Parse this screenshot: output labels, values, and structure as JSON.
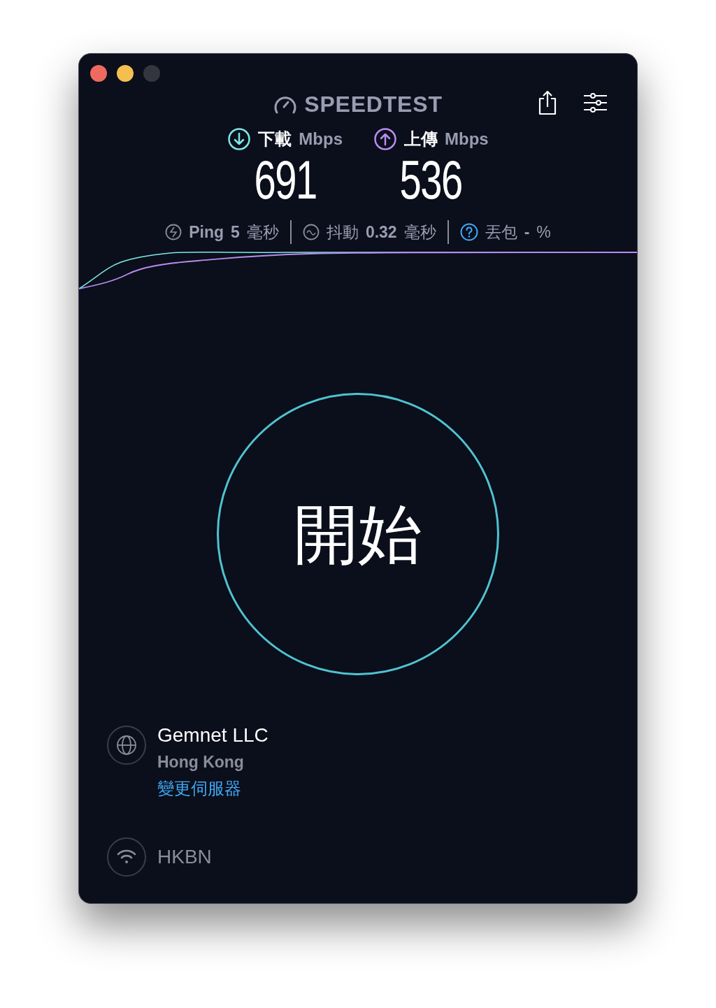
{
  "header": {
    "logo": "SPEEDTEST"
  },
  "speeds": [
    {
      "kind": "download",
      "label": "下載",
      "unit": "Mbps",
      "value": "691"
    },
    {
      "kind": "upload",
      "label": "上傳",
      "unit": "Mbps",
      "value": "536"
    }
  ],
  "stats": [
    {
      "kind": "ping",
      "label": "Ping",
      "value": "5",
      "unit": "毫秒"
    },
    {
      "kind": "jitter",
      "label": "抖動",
      "value": "0.32",
      "unit": "毫秒"
    },
    {
      "kind": "loss",
      "label": "丟包",
      "value": "-",
      "unit": "%"
    }
  ],
  "start_button": {
    "label": "開始"
  },
  "server": {
    "name": "Gemnet LLC",
    "location": "Hong Kong",
    "change_link": "變更伺服器"
  },
  "connection": {
    "provider": "HKBN"
  }
}
